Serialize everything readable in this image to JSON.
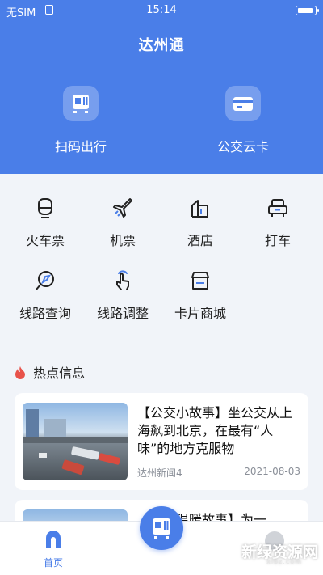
{
  "status_bar": {
    "carrier": "无SIM",
    "time": "15:14"
  },
  "header": {
    "title": "达州通"
  },
  "hero_actions": [
    {
      "label": "扫码出行",
      "icon": "bus-scan-icon"
    },
    {
      "label": "公交云卡",
      "icon": "bus-card-icon"
    }
  ],
  "services": [
    {
      "label": "火车票",
      "icon": "train-icon"
    },
    {
      "label": "机票",
      "icon": "plane-icon"
    },
    {
      "label": "酒店",
      "icon": "hotel-icon"
    },
    {
      "label": "打车",
      "icon": "taxi-icon"
    },
    {
      "label": "线路查询",
      "icon": "route-search-icon"
    },
    {
      "label": "线路调整",
      "icon": "route-adjust-icon"
    },
    {
      "label": "卡片商城",
      "icon": "card-shop-icon"
    }
  ],
  "news_section": {
    "title": "热点信息",
    "items": [
      {
        "title": "【公交小故事】坐公交从上海飙到北京，在最有“人味”的地方克服物",
        "source": "达州新闻4",
        "date": "2021-08-03"
      },
      {
        "title": "【公交温暖故事】为一",
        "source": "",
        "date": ""
      }
    ]
  },
  "tabbar": {
    "home_label": "首页"
  },
  "watermark": {
    "text": "新绿资源网",
    "sub": "xlbz.com"
  },
  "colors": {
    "primary": "#4a7ee8",
    "page_bg": "#f1f4f9"
  }
}
